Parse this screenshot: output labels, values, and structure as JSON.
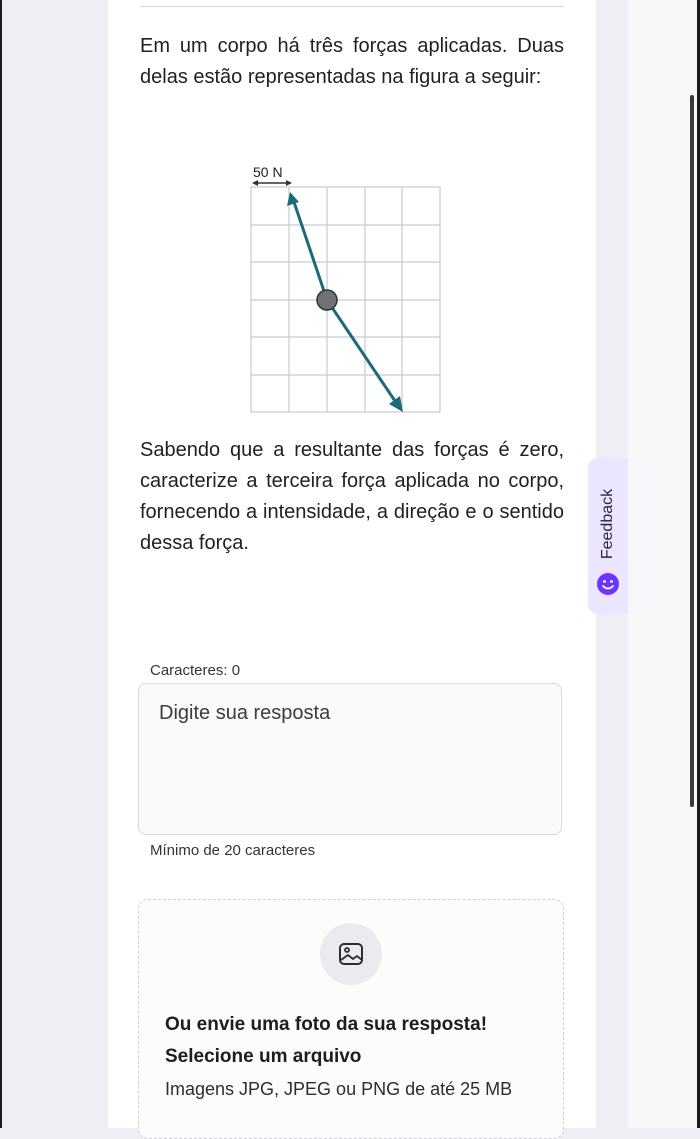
{
  "question": {
    "intro": "Em um corpo há três forças aplicadas. Duas delas estão representadas na figura a seguir:",
    "body": "Sabendo que a resultante das forças é zero, caracterize a terceira força aplicada no corpo, fornecendo a intensidade, a direção e o sentido dessa força."
  },
  "figure": {
    "scale_label": "50 N",
    "grid_columns": 5,
    "grid_rows": 6,
    "vector_color": "#1a6a7a",
    "body_color": "#6e7378"
  },
  "answer": {
    "char_count_label": "Caracteres: 0",
    "placeholder": "Digite sua resposta",
    "min_chars_label": "Mínimo de 20 caracteres"
  },
  "upload": {
    "icon": "image-icon",
    "title": "Ou envie uma foto da sua resposta!",
    "select_label": "Selecione um arquivo",
    "hint": "Imagens JPG, JPEG ou PNG de até 25 MB"
  },
  "feedback": {
    "label": "Feedback",
    "icon": "smiley-icon",
    "accent": "#6a35ff"
  }
}
